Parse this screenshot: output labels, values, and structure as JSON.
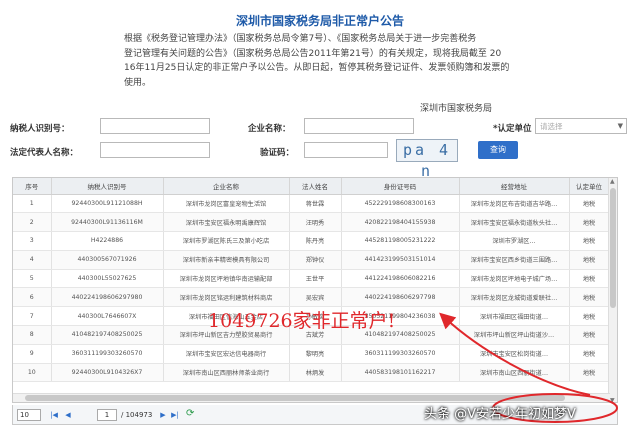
{
  "notice": {
    "title": "深圳市国家税务局非正常户公告",
    "line1": "根据《税务登记管理办法》（国家税务总局令第7号）、《国家税务总局关于进一步完善税务",
    "line2": "登记管理有关问题的公告》（国家税务总局公告2011年第21号）的有关规定，现将我局截至 20",
    "line3": "16年11月25日认定的非正常户予以公告。从即日起，暂停其税务登记证件、发票领购簿和发票的",
    "line4": "使用。",
    "signature": "深圳市国家税务局"
  },
  "form": {
    "taxpayer_id_label": "纳税人识别号：",
    "company_name_label": "企业名称：",
    "cert_unit_label": "*认定单位",
    "cert_unit_placeholder": "请选择",
    "legal_rep_label": "法定代表人名称：",
    "captcha_label": "验证码：",
    "captcha_text": "pa 4 n",
    "query_button": "查询"
  },
  "table": {
    "headers": [
      "序号",
      "纳税人识别号",
      "企业名称",
      "法人姓名",
      "身份证号码",
      "经营地址",
      "认定单位"
    ],
    "rows": [
      [
        "1",
        "92440300L91121088H",
        "深圳市龙岗区富皇宠物生活馆",
        "蒋世霖",
        "452229198608300163",
        "深圳市龙岗区布吉街道吉华路…",
        "地税"
      ],
      [
        "2",
        "92440300L91136116M",
        "深圳市宝安区福永明禹康辉馆",
        "汪明秀",
        "420822198404155938",
        "深圳市宝安区福永街道秋头社…",
        "地税"
      ],
      [
        "3",
        "H4224886",
        "深圳市罗湖区陈氏三及第小吃店",
        "陈丹亮",
        "445281198005231222",
        "深圳市罗湖区…",
        "地税"
      ],
      [
        "4",
        "440300567071926",
        "深圳市新亲丰精密模具有限公司",
        "郑钟仪",
        "441423199503151014",
        "深圳市宝安区西乡街道三围路…",
        "地税"
      ],
      [
        "5",
        "440300L55027625",
        "深圳市龙岗区坪地镇华南运输配部",
        "王世平",
        "441224198606082216",
        "深圳市龙岗区坪地电子城广场…",
        "地税"
      ],
      [
        "6",
        "440224198606297980",
        "深圳市龙岗区铭运利建筑材料商店",
        "吴宏宾",
        "440224198606297798",
        "深圳市龙岗区龙城街道爱联社…",
        "地税"
      ],
      [
        "7",
        "440300L7646607X",
        "深圳市福田区信海山五金店",
        "孙敏奕",
        "350521199804236038",
        "深圳市福田区福田街道…",
        "地税"
      ],
      [
        "8",
        "410482197408250025",
        "深圳市坪山新区吉力塑胶贸易商行",
        "古斌芳",
        "410482197408250025",
        "深圳市坪山新区坪山街道沙…",
        "地税"
      ],
      [
        "9",
        "360311199303260570",
        "深圳市宝安区宏达信电器商行",
        "黎明亮",
        "360311199303260570",
        "深圳市宝安区松岗街道…",
        "地税"
      ],
      [
        "10",
        "92440300L9104326X7",
        "深圳市南山区西丽林师茶业商行",
        "林炳发",
        "440583198101162217",
        "深圳市南山区西丽街道…",
        "地税"
      ]
    ]
  },
  "pager": {
    "page_size": "10",
    "current_page": "1",
    "total_pages": "/ 104973"
  },
  "overlay": {
    "count_text": "1049726家非正常户!",
    "watermark": "头条 @V安若少年初如梦V"
  },
  "colors": {
    "title_blue": "#1e5aa8",
    "button_blue": "#2f6fc9",
    "annotation_red": "#e0282c"
  }
}
